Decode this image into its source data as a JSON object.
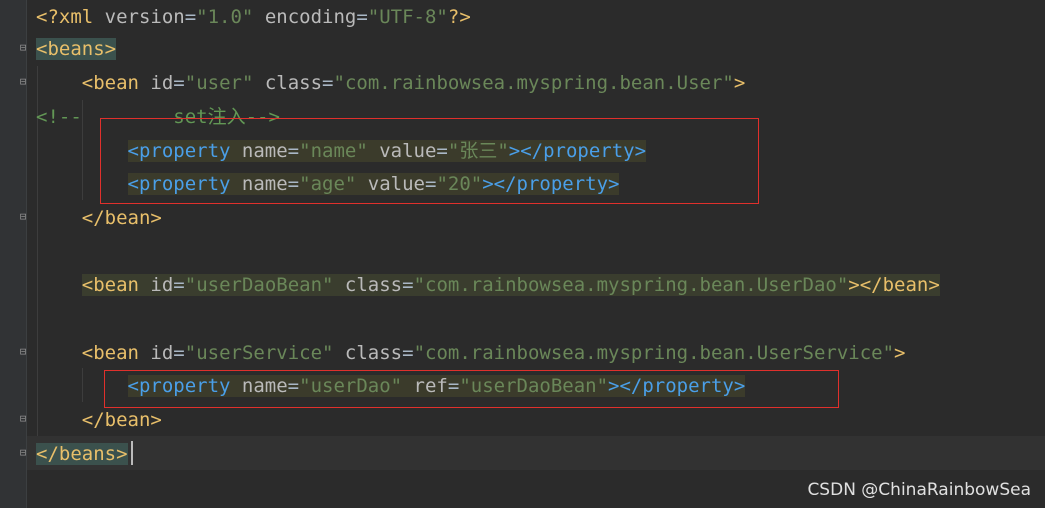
{
  "editor": {
    "lines": [
      {
        "id": "l1",
        "parts": [
          [
            "tag",
            "<?xml "
          ],
          [
            "attr",
            "version"
          ],
          [
            "plain",
            "="
          ],
          [
            "str",
            "\"1.0\""
          ],
          [
            "plain",
            " "
          ],
          [
            "attr",
            "encoding"
          ],
          [
            "plain",
            "="
          ],
          [
            "str",
            "\"UTF-8\""
          ],
          [
            "tag",
            "?>"
          ]
        ]
      },
      {
        "id": "l2",
        "parts": [
          [
            "tag",
            "<beans>"
          ]
        ]
      },
      {
        "id": "l3",
        "parts": [
          [
            "plain",
            "    "
          ],
          [
            "tag",
            "<bean "
          ],
          [
            "attr",
            "id"
          ],
          [
            "plain",
            "="
          ],
          [
            "str",
            "\"user\""
          ],
          [
            "plain",
            " "
          ],
          [
            "attr",
            "class"
          ],
          [
            "plain",
            "="
          ],
          [
            "str",
            "\"com.rainbowsea.myspring.bean.User\""
          ],
          [
            "tag",
            ">"
          ]
        ]
      },
      {
        "id": "l4",
        "parts": [
          [
            "cmt",
            "<!--        set注入-->"
          ]
        ]
      },
      {
        "id": "l5",
        "parts": [
          [
            "plain",
            "        "
          ],
          [
            "tagb",
            "<property "
          ],
          [
            "attr",
            "name"
          ],
          [
            "plain",
            "="
          ],
          [
            "str",
            "\"name\""
          ],
          [
            "plain",
            " "
          ],
          [
            "attr",
            "value"
          ],
          [
            "plain",
            "="
          ],
          [
            "str",
            "\"张三\""
          ],
          [
            "tagb",
            "></property>"
          ]
        ]
      },
      {
        "id": "l6",
        "parts": [
          [
            "plain",
            "        "
          ],
          [
            "tagb",
            "<property "
          ],
          [
            "attr",
            "name"
          ],
          [
            "plain",
            "="
          ],
          [
            "str",
            "\"age\""
          ],
          [
            "plain",
            " "
          ],
          [
            "attr",
            "value"
          ],
          [
            "plain",
            "="
          ],
          [
            "str",
            "\"20\""
          ],
          [
            "tagb",
            "></property>"
          ]
        ]
      },
      {
        "id": "l7",
        "parts": [
          [
            "plain",
            "    "
          ],
          [
            "tag",
            "</bean>"
          ]
        ]
      },
      {
        "id": "l8",
        "parts": []
      },
      {
        "id": "l9",
        "parts": [
          [
            "plain",
            "    "
          ],
          [
            "tag",
            "<bean "
          ],
          [
            "attr",
            "id"
          ],
          [
            "plain",
            "="
          ],
          [
            "str",
            "\"userDaoBean\""
          ],
          [
            "plain",
            " "
          ],
          [
            "attr",
            "class"
          ],
          [
            "plain",
            "="
          ],
          [
            "str",
            "\"com.rainbowsea.myspring.bean.UserDao\""
          ],
          [
            "tag",
            "></bean>"
          ]
        ]
      },
      {
        "id": "l10",
        "parts": []
      },
      {
        "id": "l11",
        "parts": [
          [
            "plain",
            "    "
          ],
          [
            "tag",
            "<bean "
          ],
          [
            "attr",
            "id"
          ],
          [
            "plain",
            "="
          ],
          [
            "str",
            "\"userService\""
          ],
          [
            "plain",
            " "
          ],
          [
            "attr",
            "class"
          ],
          [
            "plain",
            "="
          ],
          [
            "str",
            "\"com.rainbowsea.myspring.bean.UserService\""
          ],
          [
            "tag",
            ">"
          ]
        ]
      },
      {
        "id": "l12",
        "parts": [
          [
            "plain",
            "        "
          ],
          [
            "tagb",
            "<property "
          ],
          [
            "attr",
            "name"
          ],
          [
            "plain",
            "="
          ],
          [
            "str",
            "\"userDao\""
          ],
          [
            "plain",
            " "
          ],
          [
            "attr",
            "ref"
          ],
          [
            "plain",
            "="
          ],
          [
            "str",
            "\"userDaoBean\""
          ],
          [
            "tagb",
            "></property>"
          ]
        ]
      },
      {
        "id": "l13",
        "parts": [
          [
            "plain",
            "    "
          ],
          [
            "tag",
            "</bean>"
          ]
        ]
      },
      {
        "id": "l14",
        "parts": [
          [
            "tag",
            "</beans>"
          ]
        ]
      }
    ]
  },
  "watermark": "CSDN @ChinaRainbowSea",
  "colors": {
    "background": "#2b2b2b",
    "tag": "#e8bf6a",
    "property_tag": "#4a9fe8",
    "string": "#6a8759",
    "attribute": "#bababa",
    "comment": "#629755",
    "annotation_box": "#e0302c"
  },
  "icons": {
    "fold": "fold-marker-icon"
  }
}
